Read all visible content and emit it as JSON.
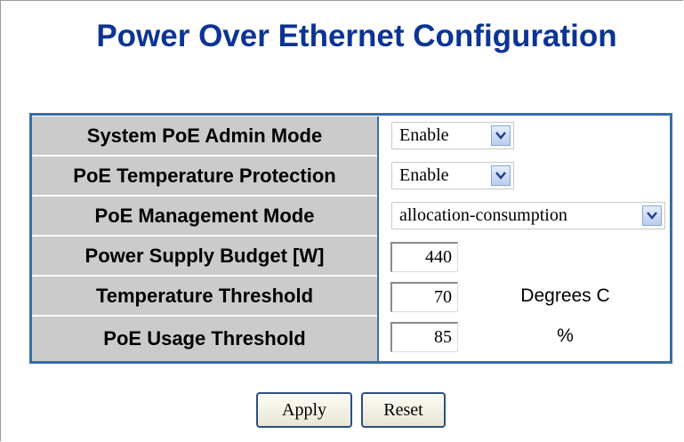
{
  "page": {
    "title": "Power Over Ethernet Configuration"
  },
  "form": {
    "rows": [
      {
        "label": "System PoE Admin Mode",
        "type": "select",
        "value": "Enable"
      },
      {
        "label": "PoE Temperature Protection",
        "type": "select",
        "value": "Enable"
      },
      {
        "label": "PoE Management Mode",
        "type": "select",
        "value": "allocation-consumption"
      },
      {
        "label": "Power Supply Budget [W]",
        "type": "input",
        "value": "440",
        "unit": ""
      },
      {
        "label": "Temperature Threshold",
        "type": "input",
        "value": "70",
        "unit": "Degrees C"
      },
      {
        "label": "PoE Usage Threshold",
        "type": "input",
        "value": "85",
        "unit": "%"
      }
    ]
  },
  "buttons": {
    "apply_label": "Apply",
    "reset_label": "Reset"
  },
  "colors": {
    "title": "#0b3494",
    "label_background": "#cbcbcb",
    "table_border": "#3a6ea5"
  },
  "icons": {
    "dropdown": "chevron-down-icon"
  }
}
